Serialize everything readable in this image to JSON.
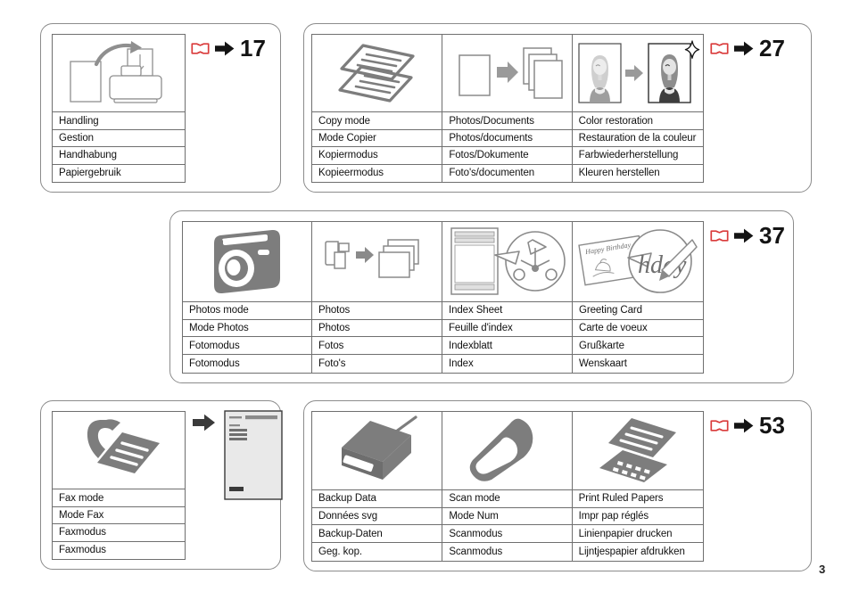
{
  "document": {
    "folio": "3",
    "accent_red": "#d93b3b",
    "ink_gray": "#7d7d7d",
    "rule_gray": "#6f6f6f"
  },
  "panels": [
    {
      "id": "handling",
      "reference": {
        "page": "17",
        "book_icon": "open-book-icon",
        "arrow_icon": "arrow-right-icon"
      },
      "columns": [
        {
          "icon": "paper-load-printer-icon",
          "labels": [
            "Handling",
            "Gestion",
            "Handhabung",
            "Papiergebruik"
          ]
        }
      ]
    },
    {
      "id": "copy",
      "reference": {
        "page": "27",
        "book_icon": "open-book-icon",
        "arrow_icon": "arrow-right-icon"
      },
      "columns": [
        {
          "icon": "stacked-documents-icon",
          "labels": [
            "Copy mode",
            "Mode Copier",
            "Kopiermodus",
            "Kopieermodus"
          ]
        },
        {
          "icon": "photos-documents-copy-icon",
          "labels": [
            "Photos/Documents",
            "Photos/documents",
            "Fotos/Dokumente",
            "Foto's/documenten"
          ]
        },
        {
          "icon": "color-restoration-icon",
          "labels": [
            "Color restoration",
            "Restauration de la couleur",
            "Farbwiederherstellung",
            "Kleuren herstellen"
          ]
        }
      ]
    },
    {
      "id": "photos",
      "reference": {
        "page": "37",
        "book_icon": "open-book-icon",
        "arrow_icon": "arrow-right-icon"
      },
      "columns": [
        {
          "icon": "camera-icon",
          "labels": [
            "Photos mode",
            "Mode Photos",
            "Fotomodus",
            "Fotomodus"
          ]
        },
        {
          "icon": "memory-card-to-photos-icon",
          "labels": [
            "Photos",
            "Photos",
            "Fotos",
            "Foto's"
          ]
        },
        {
          "icon": "index-sheet-icon",
          "labels": [
            "Index Sheet",
            "Feuille d'index",
            "Indexblatt",
            "Index"
          ]
        },
        {
          "icon": "greeting-card-icon",
          "labels": [
            "Greeting Card",
            "Carte de voeux",
            "Grußkarte",
            "Wenskaart"
          ]
        }
      ]
    },
    {
      "id": "fax",
      "reference": null,
      "side_illustration": {
        "arrow_icon": "arrow-right-icon",
        "sheet_icon": "fax-report-sheet-icon"
      },
      "columns": [
        {
          "icon": "fax-handset-document-icon",
          "labels": [
            "Fax mode",
            "Mode Fax",
            "Faxmodus",
            "Faxmodus"
          ]
        }
      ]
    },
    {
      "id": "backup-scan",
      "reference": {
        "page": "53",
        "book_icon": "open-book-icon",
        "arrow_icon": "arrow-right-icon"
      },
      "columns": [
        {
          "icon": "backup-disc-drive-icon",
          "labels": [
            "Backup Data",
            "Données svg",
            "Backup-Daten",
            "Geg. kop."
          ]
        },
        {
          "icon": "scanner-lid-icon",
          "labels": [
            "Scan mode",
            "Mode Num",
            "Scanmodus",
            "Scanmodus"
          ]
        },
        {
          "icon": "ruled-paper-icon",
          "labels": [
            "Print Ruled Papers",
            "Impr pap réglés",
            "Linienpapier drucken",
            "Lijntjespapier afdrukken"
          ]
        }
      ]
    }
  ]
}
